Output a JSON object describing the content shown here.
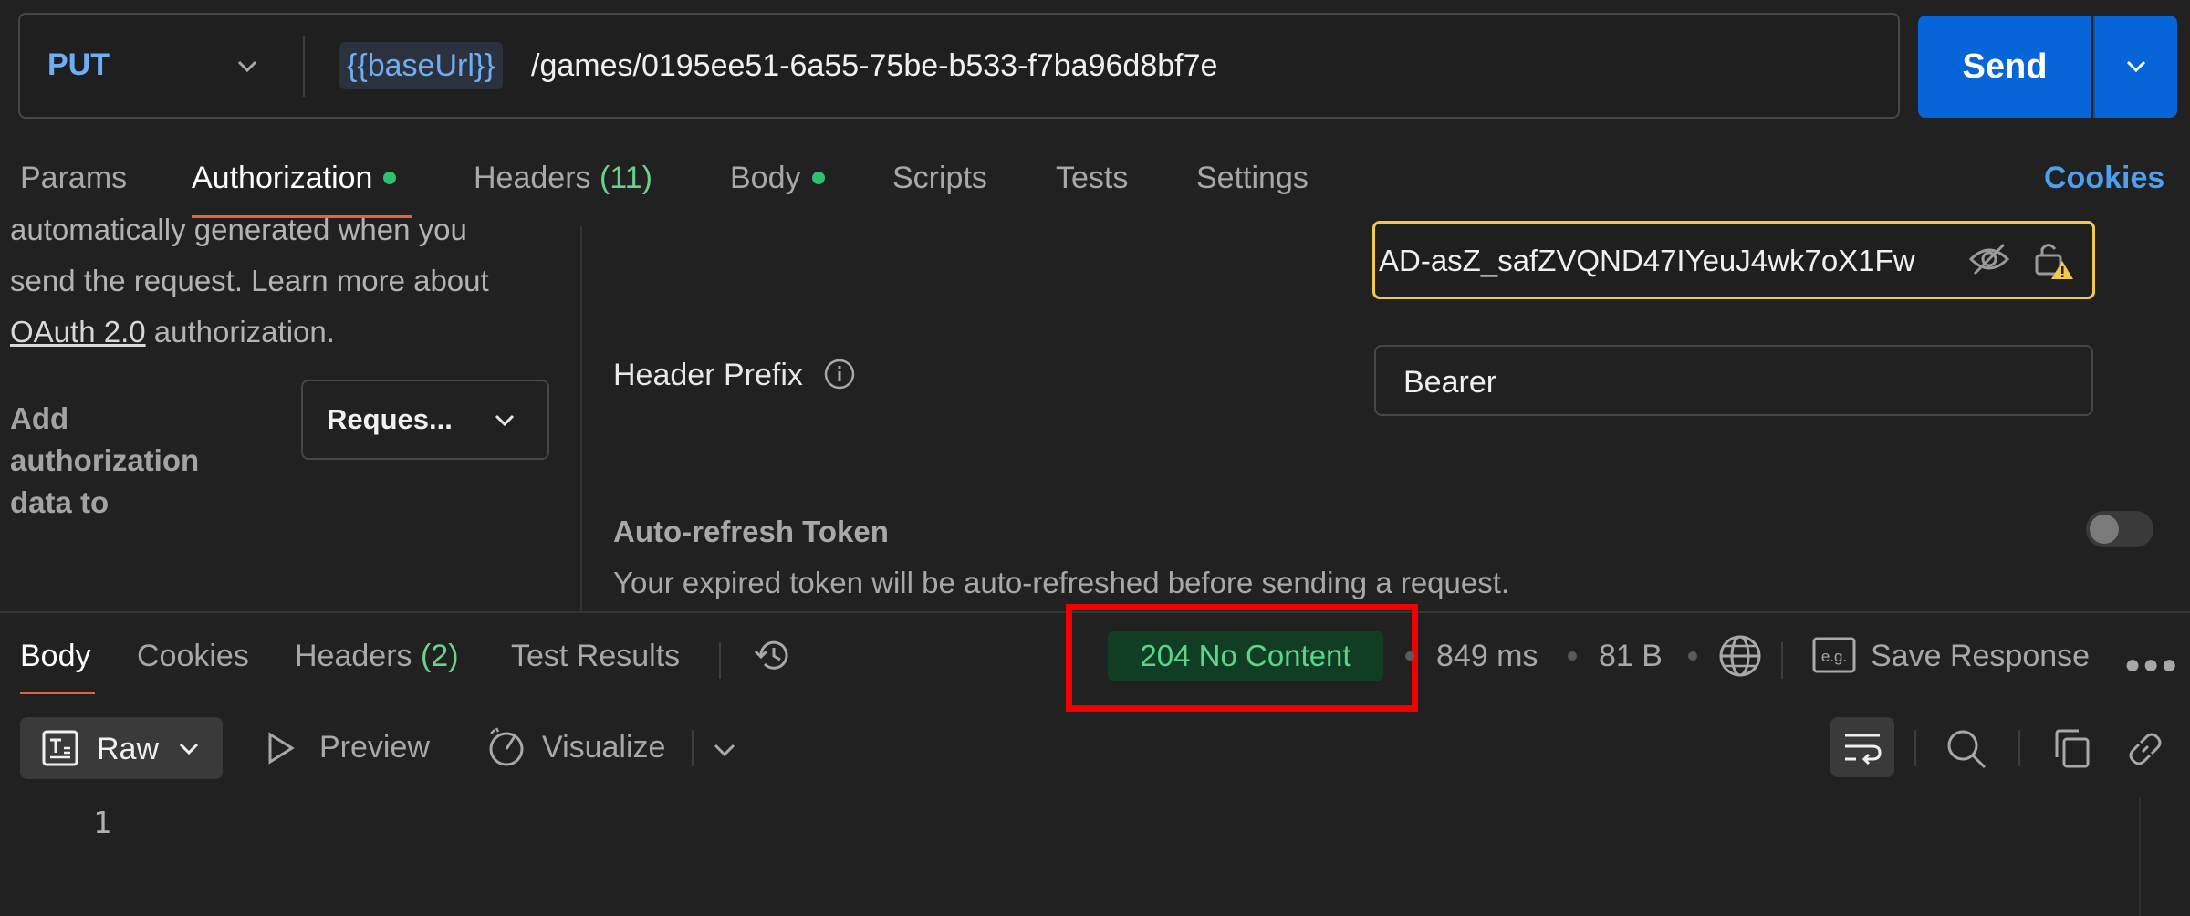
{
  "request": {
    "method": "PUT",
    "url_variable": "{{baseUrl}}",
    "url_path": "/games/0195ee51-6a55-75be-b533-f7ba96d8bf7e",
    "send_label": "Send"
  },
  "request_tabs": {
    "params": "Params",
    "authorization": "Authorization",
    "headers": "Headers",
    "headers_count": "(11)",
    "body": "Body",
    "scripts": "Scripts",
    "tests": "Tests",
    "settings": "Settings",
    "cookies": "Cookies"
  },
  "auth": {
    "desc_line1": "automatically generated when you",
    "desc_line2": "send the request. Learn more about",
    "desc_link": "OAuth 2.0",
    "desc_line3_rest": " authorization.",
    "add_auth_line1": "Add",
    "add_auth_line2": "authorization",
    "add_auth_line3": "data to",
    "add_to_value": "Reques...",
    "token_value": "AD-asZ_safZVQND47IYeuJ4wk7oX1Fw",
    "header_prefix_label": "Header Prefix",
    "header_prefix_value": "Bearer",
    "autorefresh_title": "Auto-refresh Token",
    "autorefresh_desc": "Your expired token will be auto-refreshed before sending a request."
  },
  "response": {
    "tabs": {
      "body": "Body",
      "cookies": "Cookies",
      "headers": "Headers",
      "headers_count": "(2)",
      "test_results": "Test Results"
    },
    "status": "204 No Content",
    "time": "849 ms",
    "size": "81 B",
    "save_response": "Save Response",
    "format": "Raw",
    "preview": "Preview",
    "visualize": "Visualize",
    "line_number": "1"
  },
  "colors": {
    "accent_orange": "#e8623a",
    "send_blue": "#0565d9",
    "status_green": "#57d787",
    "highlight_red": "#f20000",
    "token_border": "#f2c94c"
  }
}
